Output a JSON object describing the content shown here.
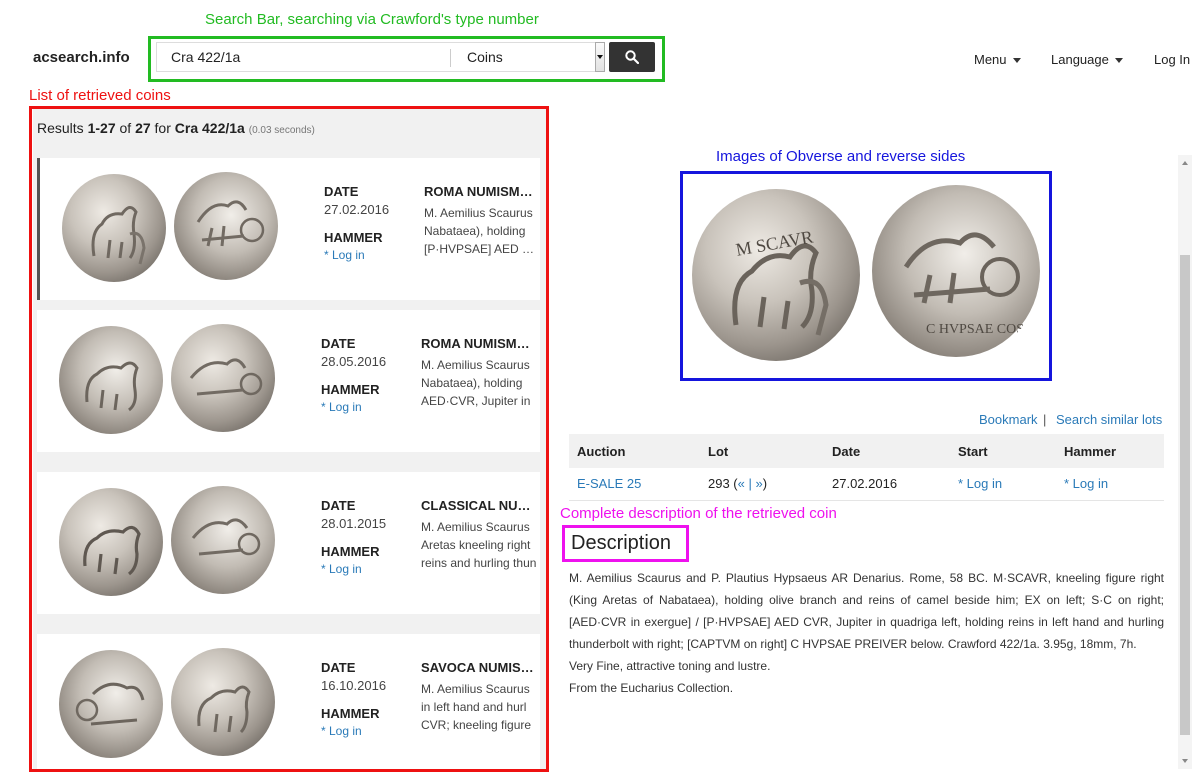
{
  "annotations": {
    "search_bar": "Search Bar, searching via Crawford's type number",
    "coins_list": "List of retrieved coins",
    "images": "Images of Obverse and reverse sides",
    "description": "Complete description of the retrieved coin",
    "colors": {
      "search": "#22bb22",
      "list": "#ee1111",
      "images": "#1515dd",
      "description": "#ee11ee"
    }
  },
  "navbar": {
    "brand": "acsearch.info",
    "search": {
      "value": "Cra 422/1a",
      "category": "Coins"
    },
    "menu_label": "Menu",
    "language_label": "Language",
    "login_label": "Log In"
  },
  "results": {
    "prefix": "Results ",
    "range": "1-27",
    "of": " of ",
    "total": "27",
    "for": " for ",
    "query": "Cra 422/1a",
    "time": "(0.03 seconds)",
    "items": [
      {
        "date_label": "DATE",
        "date": "27.02.2016",
        "hammer_label": "HAMMER",
        "login": "* Log in",
        "house": "ROMA NUMISMATICS",
        "line1": "M. Aemilius Scaurus",
        "line2": "Nabataea), holding",
        "line3": "[P·HVPSAE] AED CVR"
      },
      {
        "date_label": "DATE",
        "date": "28.05.2016",
        "hammer_label": "HAMMER",
        "login": "* Log in",
        "house": "ROMA NUMISMATICS",
        "line1": "M. Aemilius Scaurus",
        "line2": "Nabataea), holding",
        "line3": "AED·CVR, Jupiter in"
      },
      {
        "date_label": "DATE",
        "date": "28.01.2015",
        "hammer_label": "HAMMER",
        "login": "* Log in",
        "house": "CLASSICAL NUMISMATIC",
        "line1": "M. Aemilius Scaurus",
        "line2": "Aretas kneeling right",
        "line3": "reins and hurling thun"
      },
      {
        "date_label": "DATE",
        "date": "16.10.2016",
        "hammer_label": "HAMMER",
        "login": "* Log in",
        "house": "SAVOCA NUMISMATIK",
        "line1": "M. Aemilius Scaurus",
        "line2": "in left hand and hurl",
        "line3": "CVR; kneeling figure"
      }
    ]
  },
  "detail": {
    "bookmark": "Bookmark",
    "sep": "|",
    "similar": "Search similar lots",
    "table": {
      "headers": [
        "Auction",
        "Lot",
        "Date",
        "Start",
        "Hammer"
      ],
      "row": {
        "auction": "E-SALE 25",
        "lot_num": "293 (",
        "prev": "«",
        "pipe": " | ",
        "next": "»",
        "lot_end": ")",
        "date": "27.02.2016",
        "start": "* Log in",
        "hammer": "* Log in"
      }
    },
    "desc_title": "Description",
    "desc_p1": "M. Aemilius Scaurus and P. Plautius Hypsaeus AR Denarius. Rome, 58 BC. M·SCAVR, kneeling figure right (King Aretas of Nabataea), holding olive branch and reins of camel beside him; EX on left; S·C on right; [AED·CVR in exergue] / [P·HVPSAE] AED CVR, Jupiter in quadriga left, holding reins in left hand and hurling thunderbolt with right; [CAPTVM on right] C HVPSAE PREIVER below. Crawford 422/1a. 3.95g, 18mm, 7h.",
    "desc_p2": "Very Fine, attractive toning and lustre.",
    "desc_p3": "From the Eucharius Collection."
  }
}
